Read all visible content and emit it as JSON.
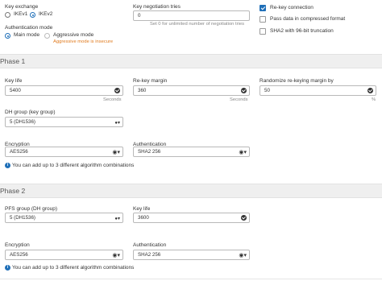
{
  "key_exchange": {
    "label": "Key exchange",
    "options": [
      "IKEv1",
      "IKEv2"
    ],
    "selected": "IKEv2"
  },
  "auth_mode": {
    "label": "Authentication mode",
    "options": [
      "Main mode",
      "Aggressive mode"
    ],
    "selected": "Main mode",
    "warning": "Aggressive mode is insecure"
  },
  "negotiation": {
    "label": "Key negotiation tries",
    "value": "0",
    "hint": "Set 0 for unlimited number of negotiation tries"
  },
  "options": [
    {
      "label": "Re-key connection",
      "checked": true
    },
    {
      "label": "Pass data in compressed format",
      "checked": false
    },
    {
      "label": "SHA2 with 96-bit truncation",
      "checked": false
    }
  ],
  "phase1": {
    "title": "Phase 1",
    "key_life": {
      "label": "Key life",
      "value": "5400",
      "unit": "Seconds"
    },
    "rekey_margin": {
      "label": "Re-key margin",
      "value": "360",
      "unit": "Seconds"
    },
    "randomize": {
      "label": "Randomize re-keying margin by",
      "value": "50",
      "unit": "%"
    },
    "dh_group": {
      "label": "DH group (key group)",
      "value": "5 (DH1536)"
    },
    "encryption": {
      "label": "Encryption",
      "value": "AES256"
    },
    "authentication": {
      "label": "Authentication",
      "value": "SHA2 256"
    },
    "add_note": "You can add up to 3 different algorithm combinations"
  },
  "phase2": {
    "title": "Phase 2",
    "pfs_group": {
      "label": "PFS group (DH group)",
      "value": "5 (DH1536)"
    },
    "key_life": {
      "label": "Key life",
      "value": "3600"
    },
    "encryption": {
      "label": "Encryption",
      "value": "AES256"
    },
    "authentication": {
      "label": "Authentication",
      "value": "SHA2 256"
    },
    "add_note": "You can add up to 3 different algorithm combinations"
  },
  "colors": {
    "accent": "#1f6fb8",
    "warning": "#e07b1f",
    "section_bg": "#efefef"
  }
}
